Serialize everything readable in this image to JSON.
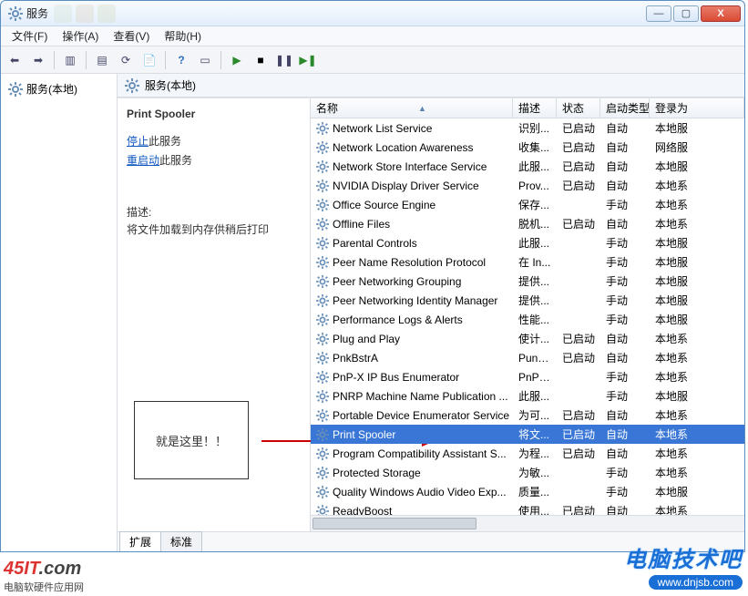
{
  "window": {
    "title": "服务"
  },
  "winbuttons": {
    "min": "—",
    "max": "▢",
    "close": "X"
  },
  "menu": {
    "file": "文件(F)",
    "action": "操作(A)",
    "view": "查看(V)",
    "help": "帮助(H)"
  },
  "tree": {
    "root": "服务(本地)"
  },
  "right_header": "服务(本地)",
  "details": {
    "name": "Print Spooler",
    "stop_prefix": "停止",
    "stop_suffix": "此服务",
    "restart_prefix": "重启动",
    "restart_suffix": "此服务",
    "desc_label": "描述:",
    "desc_text": "将文件加载到内存供稍后打印"
  },
  "callout": {
    "text": "就是这里！！"
  },
  "columns": {
    "name": "名称",
    "desc": "描述",
    "status": "状态",
    "startup": "启动类型",
    "logon": "登录为"
  },
  "tabs": {
    "ext": "扩展",
    "std": "标准"
  },
  "services": [
    {
      "name": "Network List Service",
      "desc": "识别...",
      "status": "已启动",
      "startup": "自动",
      "logon": "本地服"
    },
    {
      "name": "Network Location Awareness",
      "desc": "收集...",
      "status": "已启动",
      "startup": "自动",
      "logon": "网络服"
    },
    {
      "name": "Network Store Interface Service",
      "desc": "此服...",
      "status": "已启动",
      "startup": "自动",
      "logon": "本地服"
    },
    {
      "name": "NVIDIA Display Driver Service",
      "desc": "Prov...",
      "status": "已启动",
      "startup": "自动",
      "logon": "本地系"
    },
    {
      "name": "Office Source Engine",
      "desc": "保存...",
      "status": "",
      "startup": "手动",
      "logon": "本地系"
    },
    {
      "name": "Offline Files",
      "desc": "脱机...",
      "status": "已启动",
      "startup": "自动",
      "logon": "本地系"
    },
    {
      "name": "Parental Controls",
      "desc": "此服...",
      "status": "",
      "startup": "手动",
      "logon": "本地服"
    },
    {
      "name": "Peer Name Resolution Protocol",
      "desc": "在 In...",
      "status": "",
      "startup": "手动",
      "logon": "本地服"
    },
    {
      "name": "Peer Networking Grouping",
      "desc": "提供...",
      "status": "",
      "startup": "手动",
      "logon": "本地服"
    },
    {
      "name": "Peer Networking Identity Manager",
      "desc": "提供...",
      "status": "",
      "startup": "手动",
      "logon": "本地服"
    },
    {
      "name": "Performance Logs & Alerts",
      "desc": "性能...",
      "status": "",
      "startup": "手动",
      "logon": "本地服"
    },
    {
      "name": "Plug and Play",
      "desc": "使计...",
      "status": "已启动",
      "startup": "自动",
      "logon": "本地系"
    },
    {
      "name": "PnkBstrA",
      "desc": "Punk...",
      "status": "已启动",
      "startup": "自动",
      "logon": "本地系"
    },
    {
      "name": "PnP-X IP Bus Enumerator",
      "desc": "PnP-...",
      "status": "",
      "startup": "手动",
      "logon": "本地系"
    },
    {
      "name": "PNRP Machine Name Publication ...",
      "desc": "此服...",
      "status": "",
      "startup": "手动",
      "logon": "本地服"
    },
    {
      "name": "Portable Device Enumerator Service",
      "desc": "为可...",
      "status": "已启动",
      "startup": "自动",
      "logon": "本地系"
    },
    {
      "name": "Print Spooler",
      "desc": "将文...",
      "status": "已启动",
      "startup": "自动",
      "logon": "本地系",
      "selected": true
    },
    {
      "name": "Program Compatibility Assistant S...",
      "desc": "为程...",
      "status": "已启动",
      "startup": "自动",
      "logon": "本地系"
    },
    {
      "name": "Protected Storage",
      "desc": "为敏...",
      "status": "",
      "startup": "手动",
      "logon": "本地系"
    },
    {
      "name": "Quality Windows Audio Video Exp...",
      "desc": "质量...",
      "status": "",
      "startup": "手动",
      "logon": "本地服"
    },
    {
      "name": "ReadyBoost",
      "desc": "使用...",
      "status": "已启动",
      "startup": "自动",
      "logon": "本地系"
    }
  ],
  "logos": {
    "left_brand": "45IT",
    "left_tld": ".com",
    "left_sub": "电脑软硬件应用网",
    "right_cn": "电脑技术吧",
    "right_url": "www.dnjsb.com"
  }
}
